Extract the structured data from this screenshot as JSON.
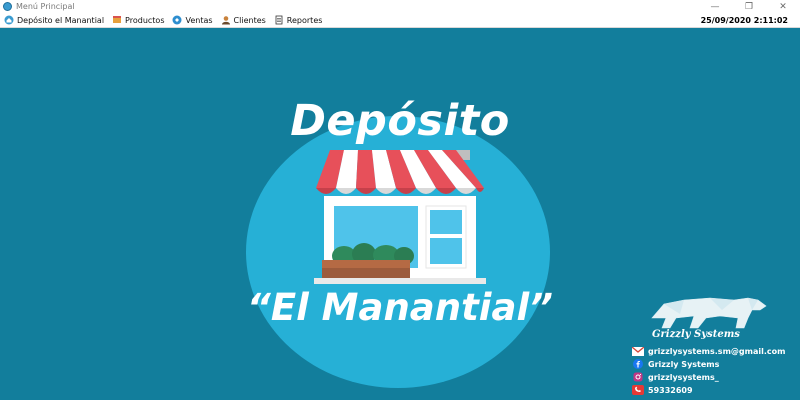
{
  "window": {
    "title": "Menú Principal",
    "controls": {
      "minimize": "—",
      "maximize": "❐",
      "close": "✕"
    }
  },
  "menubar": {
    "items": [
      {
        "label": "Depósito el Manantial",
        "icon": "app-circle-icon"
      },
      {
        "label": "Productos",
        "icon": "products-icon"
      },
      {
        "label": "Ventas",
        "icon": "sales-icon"
      },
      {
        "label": "Clientes",
        "icon": "clients-icon"
      },
      {
        "label": "Reportes",
        "icon": "reports-icon"
      }
    ],
    "datetime": "25/09/2020 2:11:02"
  },
  "brand": {
    "line1": "Depósito",
    "line2": "“El Manantial”",
    "colors": {
      "background": "#127e9c",
      "circle": "#26b0d6",
      "awning_red": "#e7505a",
      "awning_white": "#ffffff",
      "window": "#4fc3ea",
      "plant": "#2f8a5c",
      "planter": "#9c5b3c"
    }
  },
  "grizzly": {
    "name": "Grizzly Systems",
    "contacts": [
      {
        "icon": "email-icon",
        "text": "grizzlysystems.sm@gmail.com"
      },
      {
        "icon": "facebook-icon",
        "text": "Grizzly Systems"
      },
      {
        "icon": "instagram-icon",
        "text": "grizzlysystems_"
      },
      {
        "icon": "phone-icon",
        "text": "59332609"
      }
    ]
  }
}
